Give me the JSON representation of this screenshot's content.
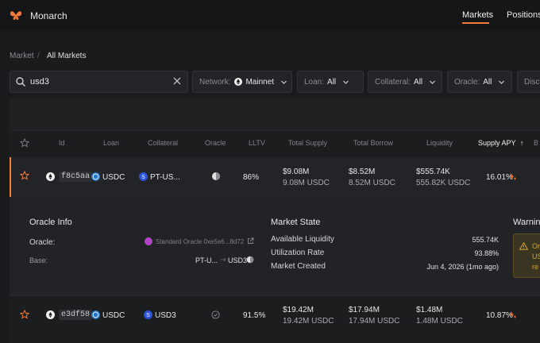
{
  "app": {
    "title": "Monarch"
  },
  "nav": {
    "markets": "Markets",
    "positions": "Positions"
  },
  "breadcrumb": {
    "market": "Market",
    "separator": "/",
    "all_markets": "All Markets"
  },
  "search": {
    "value": "usd3"
  },
  "filters": {
    "network_label": "Network:",
    "network_value": "Mainnet",
    "loan_label": "Loan:",
    "loan_value": "All",
    "collateral_label": "Collateral:",
    "collateral_value": "All",
    "oracle_label": "Oracle:",
    "oracle_value": "All",
    "discover_label": "Disco"
  },
  "table": {
    "headers": {
      "id": "Id",
      "loan": "Loan",
      "collateral": "Collateral",
      "oracle": "Oracle",
      "lltv": "LLTV",
      "total_supply": "Total Supply",
      "total_borrow": "Total Borrow",
      "liquidity": "Liquidity",
      "supply_apy": "Supply APY",
      "supply_apy_arrow": "↑",
      "borrow_apy": "B"
    },
    "rows": [
      {
        "id": "f8c5aa",
        "loan": "USDC",
        "collateral": "PT-US...",
        "lltv": "86%",
        "supply_usd": "$9.08M",
        "supply_token": "9.08M USDC",
        "borrow_usd": "$8.52M",
        "borrow_token": "8.52M USDC",
        "liquidity_usd": "$555.74K",
        "liquidity_token": "555.82K USDC",
        "apy": "16.01%"
      },
      {
        "id": "e3df58",
        "loan": "USDC",
        "collateral": "USD3",
        "lltv": "91.5%",
        "supply_usd": "$19.42M",
        "supply_token": "19.42M USDC",
        "borrow_usd": "$17.94M",
        "borrow_token": "17.94M USDC",
        "liquidity_usd": "$1.48M",
        "liquidity_token": "1.48M USDC",
        "apy": "10.87%"
      }
    ]
  },
  "detail": {
    "oracle_info_title": "Oracle Info",
    "oracle_label": "Oracle:",
    "oracle_value": "Standard Oracle 0xe5e6...8d72",
    "base_label": "Base:",
    "base_value": "PT-U...",
    "base_quote": "USD3",
    "market_state_title": "Market State",
    "available_liquidity_label": "Available Liquidity",
    "available_liquidity_value": "555.74K",
    "utilization_label": "Utilization Rate",
    "utilization_value": "93.88%",
    "created_label": "Market Created",
    "created_value": "Jun 4, 2026 (1mo ago)",
    "warnings_title": "Warnin",
    "warning_text_1": "Or",
    "warning_text_2": "US",
    "warning_text_3": "re"
  },
  "colors": {
    "accent": "#f47b39",
    "usdc": "#2775ca",
    "pt_token": "#2a52d9",
    "warning": "#d7a52a"
  }
}
